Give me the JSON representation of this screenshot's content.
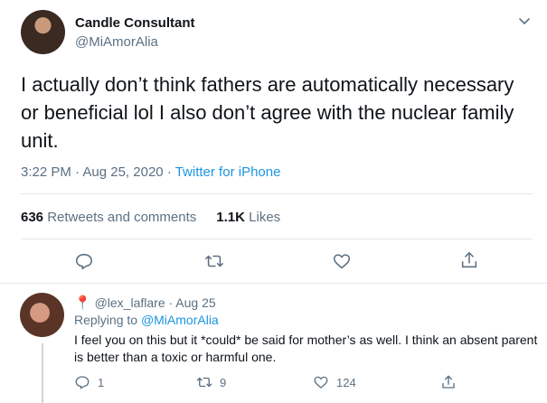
{
  "tweet": {
    "author_name": "Candle Consultant",
    "author_handle": "@MiAmorAlia",
    "text": "I actually don’t think fathers are automatically necessary or beneficial lol I also don’t agree with the nuclear family unit.",
    "time": "3:22 PM",
    "date": "Aug 25, 2020",
    "separator": "·",
    "source": "Twitter for iPhone",
    "retweets_count": "636",
    "retweets_label": "Retweets and comments",
    "likes_count": "1.1K",
    "likes_label": "Likes",
    "actions": {
      "reply": "reply-icon",
      "retweet": "retweet-icon",
      "like": "heart-icon",
      "share": "share-icon"
    }
  },
  "reply": {
    "pin_icon": "📍",
    "handle": "@lex_laflare",
    "date": "Aug 25",
    "replying_label": "Replying to",
    "replying_to": "@MiAmorAlia",
    "text": "I feel you on this but it *could* be said for mother’s as well. I think an absent parent is better than a toxic or harmful one.",
    "reply_count": "1",
    "retweet_count": "9",
    "like_count": "124"
  },
  "colors": {
    "text": "#0f1419",
    "secondary": "#5b7083",
    "link": "#1b95e0",
    "divider": "#e1e8ed"
  }
}
